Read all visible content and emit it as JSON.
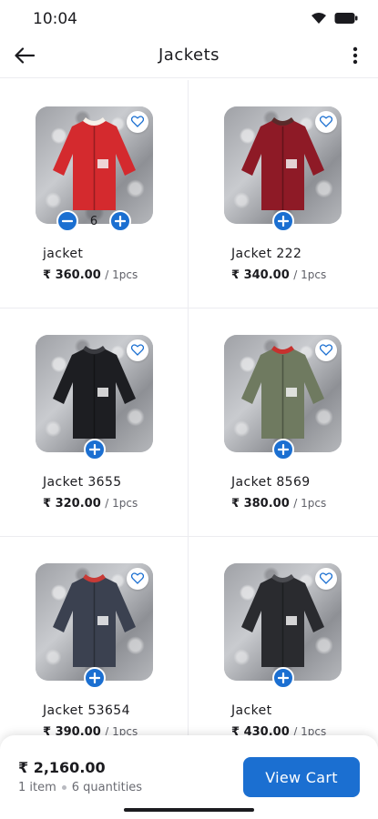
{
  "status_bar": {
    "time": "10:04"
  },
  "app_bar": {
    "title": "Jackets",
    "back_icon": "arrow-left-icon",
    "menu_icon": "more-vertical-icon"
  },
  "products": [
    {
      "name": "jacket",
      "price": "₹ 360.00",
      "unit": "/ 1pcs",
      "in_cart": true,
      "quantity": "6",
      "jacket_color": "#d42a2e",
      "jacket_trim": "#f6f0e8"
    },
    {
      "name": "Jacket 222",
      "price": "₹ 340.00",
      "unit": "/ 1pcs",
      "in_cart": false,
      "jacket_color": "#8e1a26",
      "jacket_trim": "#5a2a2a"
    },
    {
      "name": "Jacket 3655",
      "price": "₹ 320.00",
      "unit": "/ 1pcs",
      "in_cart": false,
      "jacket_color": "#1d1e22",
      "jacket_trim": "#3a3b40"
    },
    {
      "name": "Jacket 8569",
      "price": "₹ 380.00",
      "unit": "/ 1pcs",
      "in_cart": false,
      "jacket_color": "#6f7a60",
      "jacket_trim": "#c6312e"
    },
    {
      "name": "Jacket 53654",
      "price": "₹ 390.00",
      "unit": "/ 1pcs",
      "in_cart": false,
      "jacket_color": "#3b4150",
      "jacket_trim": "#c83a36"
    },
    {
      "name": "Jacket",
      "price": "₹ 430.00",
      "unit": "/ 1pcs",
      "in_cart": false,
      "jacket_color": "#2a2b2f",
      "jacket_trim": "#4a4b50"
    }
  ],
  "cart": {
    "total": "₹ 2,160.00",
    "items": "1 item",
    "quantities": "6 quantities",
    "button_label": "View Cart"
  },
  "colors": {
    "accent": "#1b6fd1",
    "divider": "#ececf0"
  }
}
